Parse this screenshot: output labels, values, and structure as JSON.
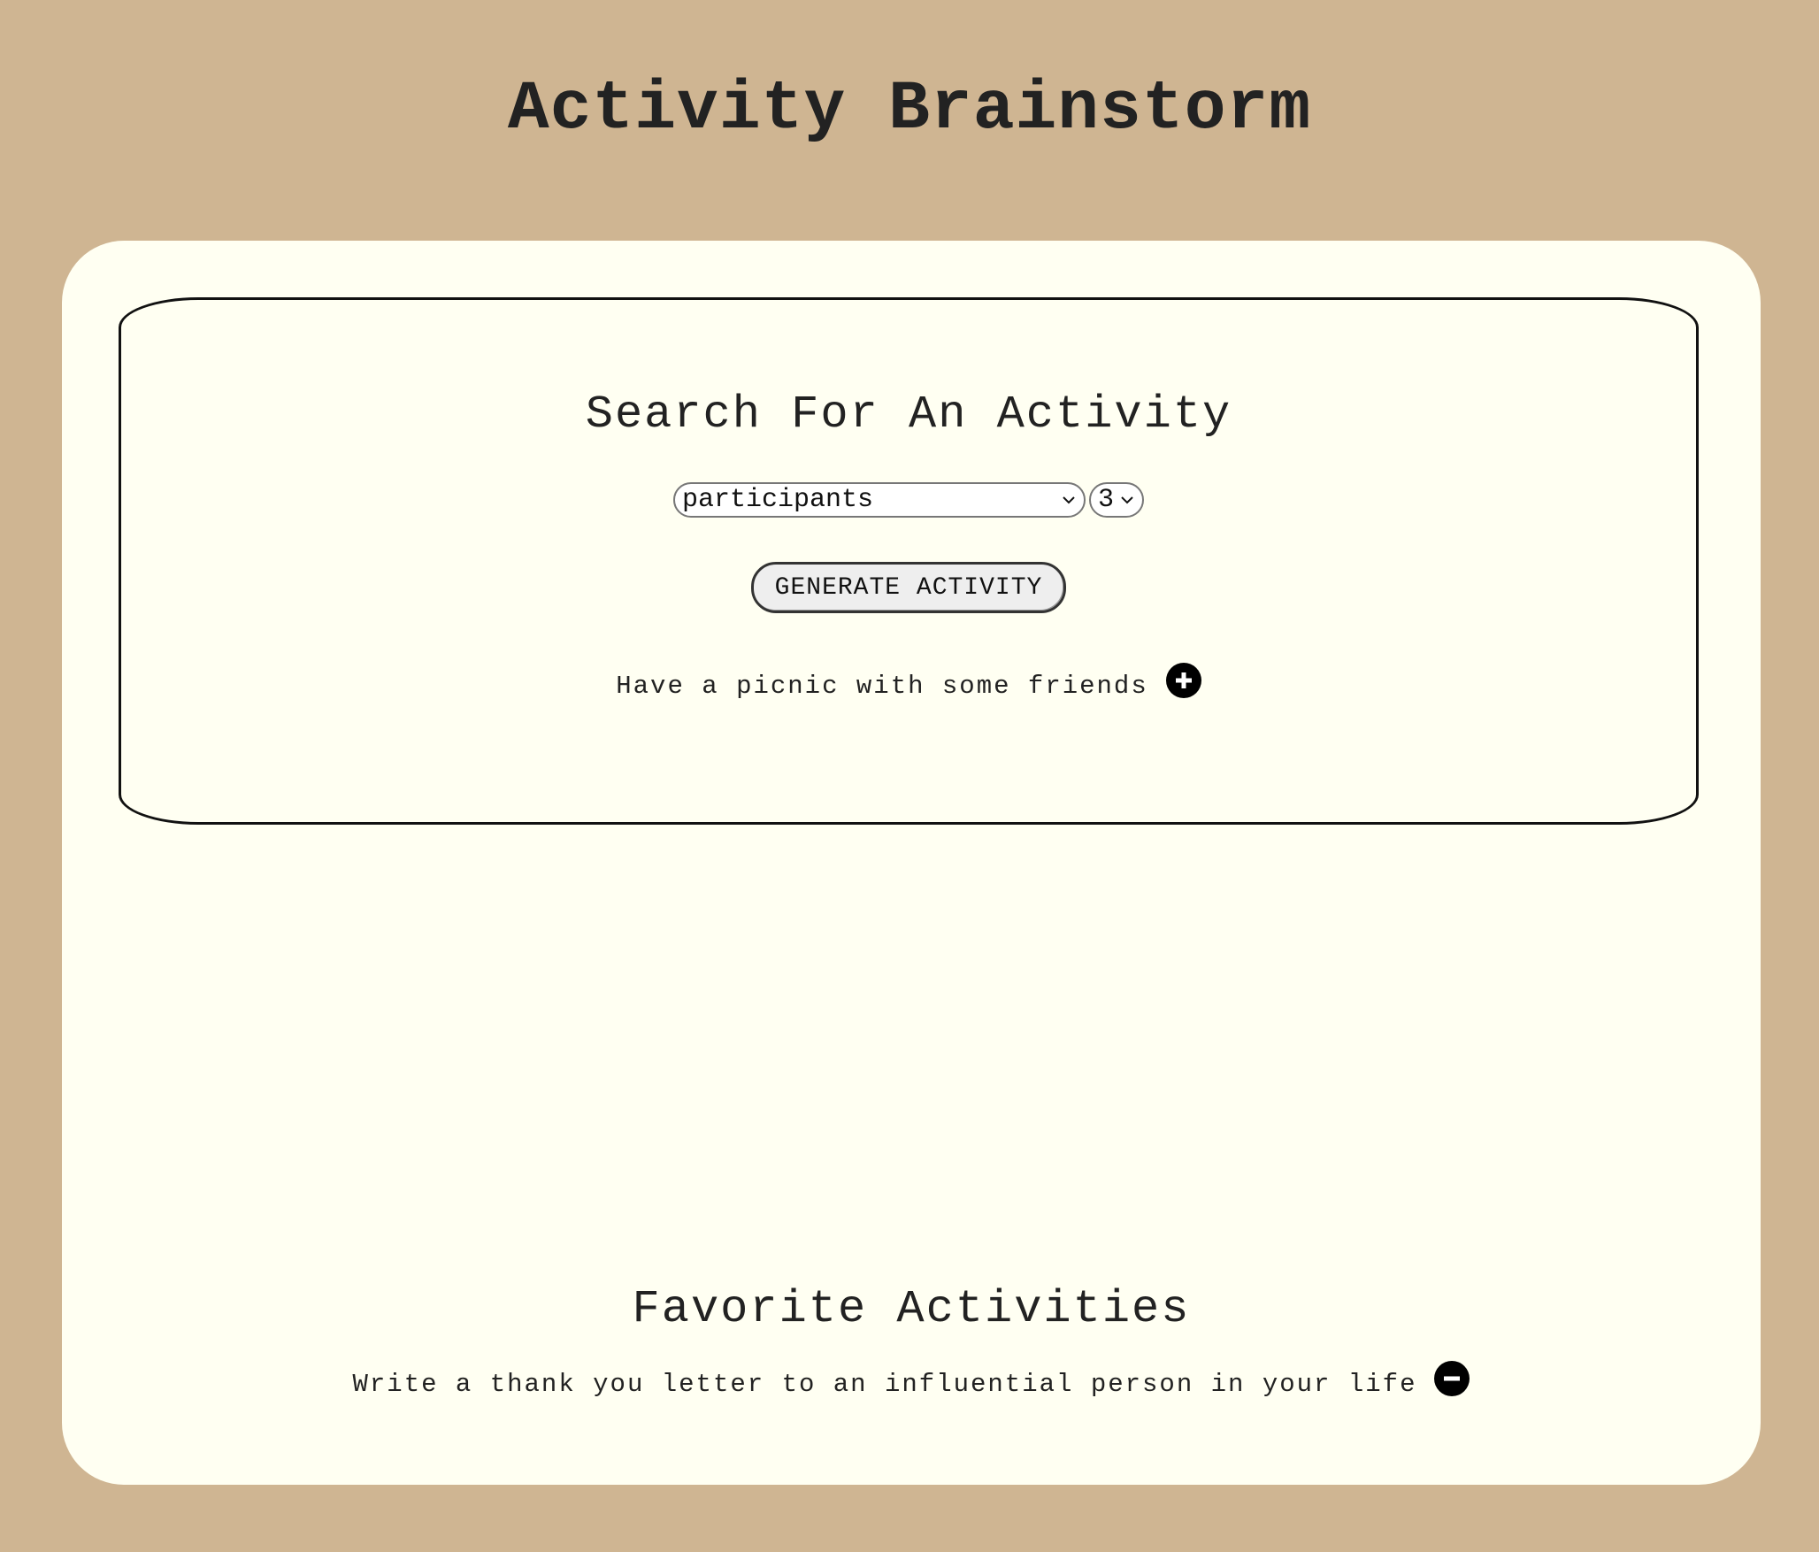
{
  "header": {
    "title": "Activity Brainstorm"
  },
  "search": {
    "title": "Search For An Activity",
    "filter_select": {
      "selected": "participants",
      "icon": "chevron-down-icon"
    },
    "count_select": {
      "selected": "3",
      "icon": "chevron-down-icon"
    },
    "generate_label": "GENERATE ACTIVITY",
    "result": {
      "text": "Have a picnic with some friends",
      "icon": "plus-circle-icon"
    }
  },
  "favorites": {
    "title": "Favorite Activities",
    "items": [
      {
        "text": "Write a thank you letter to an influential person in your life",
        "icon": "minus-circle-icon"
      }
    ]
  },
  "colors": {
    "page_background": "#cfb592",
    "card_background": "#fffff2",
    "text": "#222222",
    "icon_fill": "#000000"
  }
}
